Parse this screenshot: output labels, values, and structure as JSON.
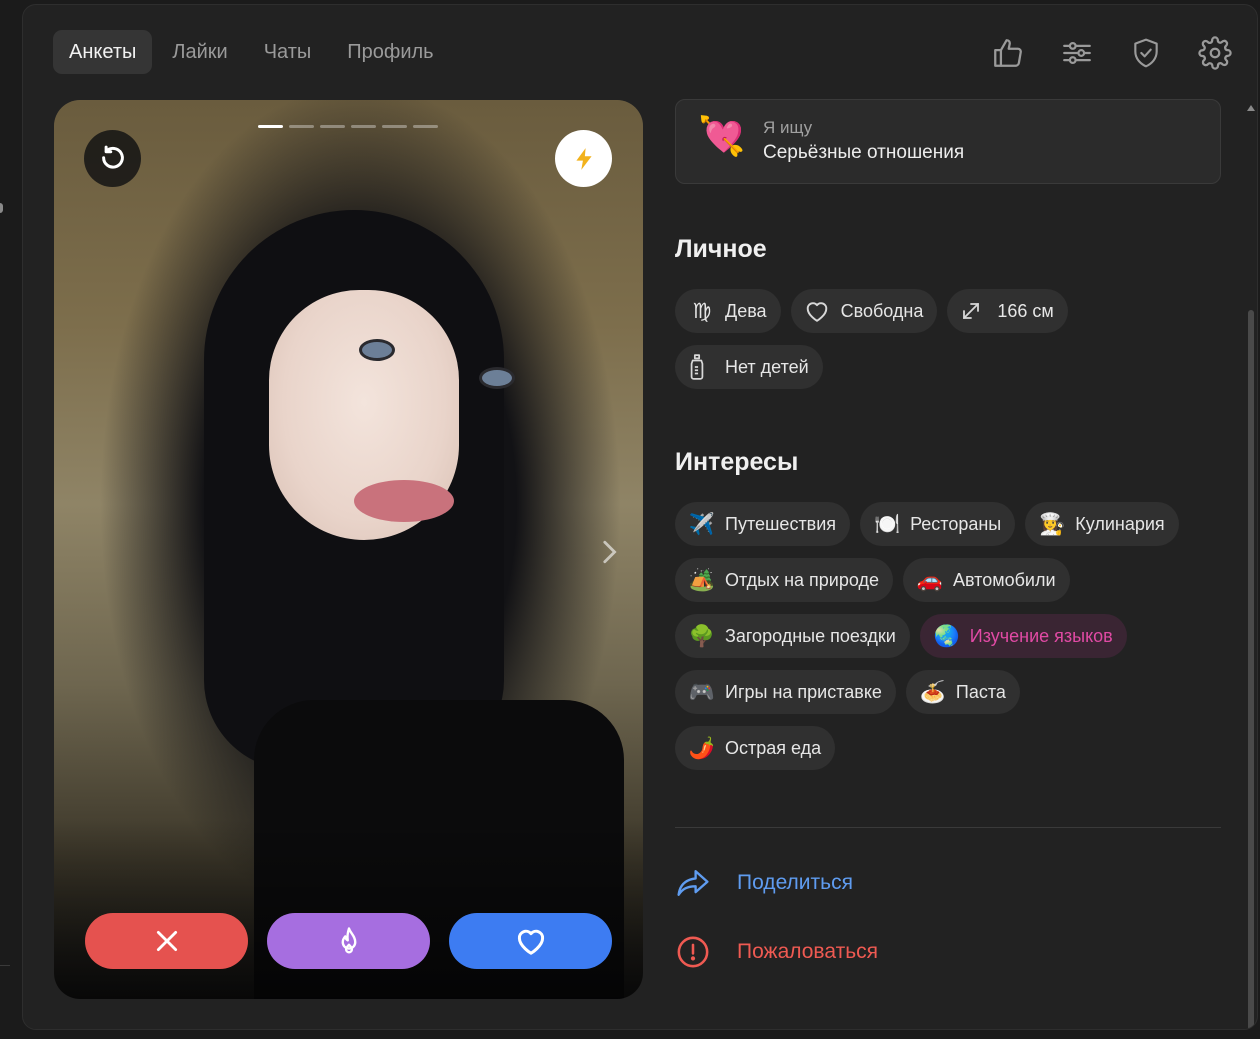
{
  "nav": {
    "tabs": [
      {
        "label": "Анкеты",
        "active": true
      },
      {
        "label": "Лайки",
        "active": false
      },
      {
        "label": "Чаты",
        "active": false
      },
      {
        "label": "Профиль",
        "active": false
      }
    ],
    "icons": [
      "thumbs-up-icon",
      "filters-icon",
      "shield-icon",
      "settings-icon"
    ]
  },
  "card": {
    "photo_count": 6,
    "photo_index": 1
  },
  "seeking": {
    "emoji": "💘",
    "label": "Я ищу",
    "value": "Серьёзные отношения"
  },
  "personal": {
    "title": "Личное",
    "chips": [
      {
        "icon": "virgo-icon",
        "label": "Дева"
      },
      {
        "icon": "heart-outline-icon",
        "label": "Свободна"
      },
      {
        "icon": "height-arrows-icon",
        "label": "166 см"
      },
      {
        "icon": "baby-bottle-icon",
        "label": "Нет детей"
      }
    ]
  },
  "interests": {
    "title": "Интересы",
    "chips": [
      {
        "emoji": "✈️",
        "label": "Путешествия",
        "highlight": false
      },
      {
        "emoji": "🍽️",
        "label": "Рестораны",
        "highlight": false
      },
      {
        "emoji": "👩‍🍳",
        "label": "Кулинария",
        "highlight": false
      },
      {
        "emoji": "🏕️",
        "label": "Отдых на природе",
        "highlight": false
      },
      {
        "emoji": "🚗",
        "label": "Автомобили",
        "highlight": false
      },
      {
        "emoji": "🌳",
        "label": "Загородные поездки",
        "highlight": false
      },
      {
        "emoji": "🌏",
        "label": "Изучение языков",
        "highlight": true
      },
      {
        "emoji": "🎮",
        "label": "Игры на приставке",
        "highlight": false
      },
      {
        "emoji": "🍝",
        "label": "Паста",
        "highlight": false
      },
      {
        "emoji": "🌶️",
        "label": "Острая еда",
        "highlight": false
      }
    ]
  },
  "links": {
    "share": "Поделиться",
    "report": "Пожаловаться"
  },
  "colors": {
    "dislike": "#e5524f",
    "superlike": "#a66ee0",
    "like": "#3d7cf2",
    "share": "#5f9cf0",
    "report": "#ef5a52",
    "highlight_text": "#e04aa4"
  }
}
